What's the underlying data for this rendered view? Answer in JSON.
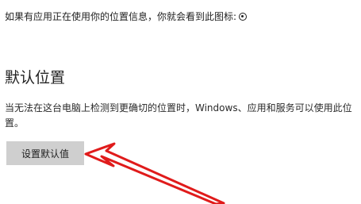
{
  "location_info": {
    "text": "如果有应用正在使用你的位置信息，你就会看到此图标:",
    "icon": "location-in-use-icon"
  },
  "default_location": {
    "heading": "默认位置",
    "description": "当无法在这台电脑上检测到更确切的位置时，Windows、应用和服务可以使用此位置。",
    "button_label": "设置默认值"
  },
  "annotation": {
    "arrow_color": "#e01b1b",
    "arrow_icon": "red-pointer-arrow"
  }
}
